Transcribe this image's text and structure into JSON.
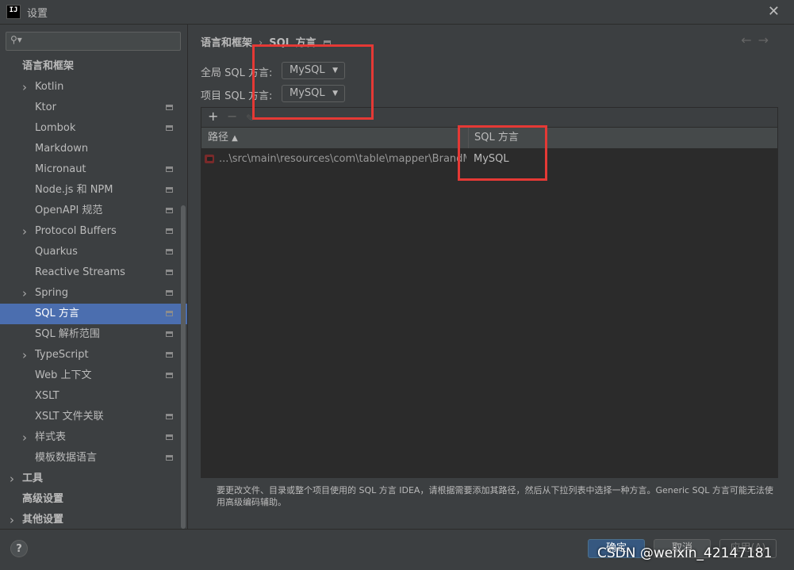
{
  "window": {
    "app_icon_text": "IJ",
    "title": "设置",
    "close_glyph": "✕"
  },
  "sidebar": {
    "search_icon": "search-icon",
    "items": [
      {
        "label": "语言和框架",
        "level": 0,
        "expandable": false,
        "bold": true,
        "project_icon": false
      },
      {
        "label": "Kotlin",
        "level": 1,
        "expandable": true,
        "project_icon": false
      },
      {
        "label": "Ktor",
        "level": 1,
        "expandable": false,
        "project_icon": true
      },
      {
        "label": "Lombok",
        "level": 1,
        "expandable": false,
        "project_icon": true
      },
      {
        "label": "Markdown",
        "level": 1,
        "expandable": false,
        "project_icon": false
      },
      {
        "label": "Micronaut",
        "level": 1,
        "expandable": false,
        "project_icon": true
      },
      {
        "label": "Node.js 和 NPM",
        "level": 1,
        "expandable": false,
        "project_icon": true
      },
      {
        "label": "OpenAPI 规范",
        "level": 1,
        "expandable": false,
        "project_icon": true
      },
      {
        "label": "Protocol Buffers",
        "level": 1,
        "expandable": true,
        "project_icon": true
      },
      {
        "label": "Quarkus",
        "level": 1,
        "expandable": false,
        "project_icon": true
      },
      {
        "label": "Reactive Streams",
        "level": 1,
        "expandable": false,
        "project_icon": true
      },
      {
        "label": "Spring",
        "level": 1,
        "expandable": true,
        "project_icon": true
      },
      {
        "label": "SQL 方言",
        "level": 1,
        "expandable": false,
        "project_icon": true,
        "selected": true
      },
      {
        "label": "SQL 解析范围",
        "level": 1,
        "expandable": false,
        "project_icon": true
      },
      {
        "label": "TypeScript",
        "level": 1,
        "expandable": true,
        "project_icon": true
      },
      {
        "label": "Web 上下文",
        "level": 1,
        "expandable": false,
        "project_icon": true
      },
      {
        "label": "XSLT",
        "level": 1,
        "expandable": false,
        "project_icon": false
      },
      {
        "label": "XSLT 文件关联",
        "level": 1,
        "expandable": false,
        "project_icon": true
      },
      {
        "label": "样式表",
        "level": 1,
        "expandable": true,
        "project_icon": true
      },
      {
        "label": "模板数据语言",
        "level": 1,
        "expandable": false,
        "project_icon": true
      },
      {
        "label": "工具",
        "level": 0,
        "expandable": true,
        "bold": true,
        "project_icon": false
      },
      {
        "label": "高级设置",
        "level": 0,
        "expandable": false,
        "bold": true,
        "project_icon": false
      },
      {
        "label": "其他设置",
        "level": 0,
        "expandable": true,
        "bold": true,
        "project_icon": false
      }
    ]
  },
  "breadcrumb": {
    "parent": "语言和框架",
    "separator": "›",
    "current": "SQL 方言"
  },
  "nav": {
    "back": "←",
    "forward": "→"
  },
  "settings": {
    "global_label": "全局 SQL 方言:",
    "global_value": "MySQL",
    "project_label": "项目 SQL 方言:",
    "project_value": "MySQL"
  },
  "table": {
    "toolbar": {
      "add": "+",
      "remove": "−",
      "edit": "✎"
    },
    "columns": [
      {
        "label": "路径",
        "sort": "▲"
      },
      {
        "label": "SQL 方言"
      }
    ],
    "rows": [
      {
        "path": "...\\src\\main\\resources\\com\\table\\mapper\\BrandMapper.xml",
        "dialect": "MySQL"
      }
    ]
  },
  "help_text": "要更改文件、目录或整个项目使用的 SQL 方言 IDEA，请根据需要添加其路径，然后从下拉列表中选择一种方言。Generic SQL 方言可能无法使用高级编码辅助。",
  "footer": {
    "help": "?",
    "ok": "确定",
    "cancel": "取消",
    "apply": "应用(A)"
  },
  "watermark": "CSDN @weixin_42147181",
  "colors": {
    "background": "#3c3f41",
    "selection": "#4b6eaf",
    "annotation_border": "#e53935",
    "primary_button": "#365880"
  }
}
